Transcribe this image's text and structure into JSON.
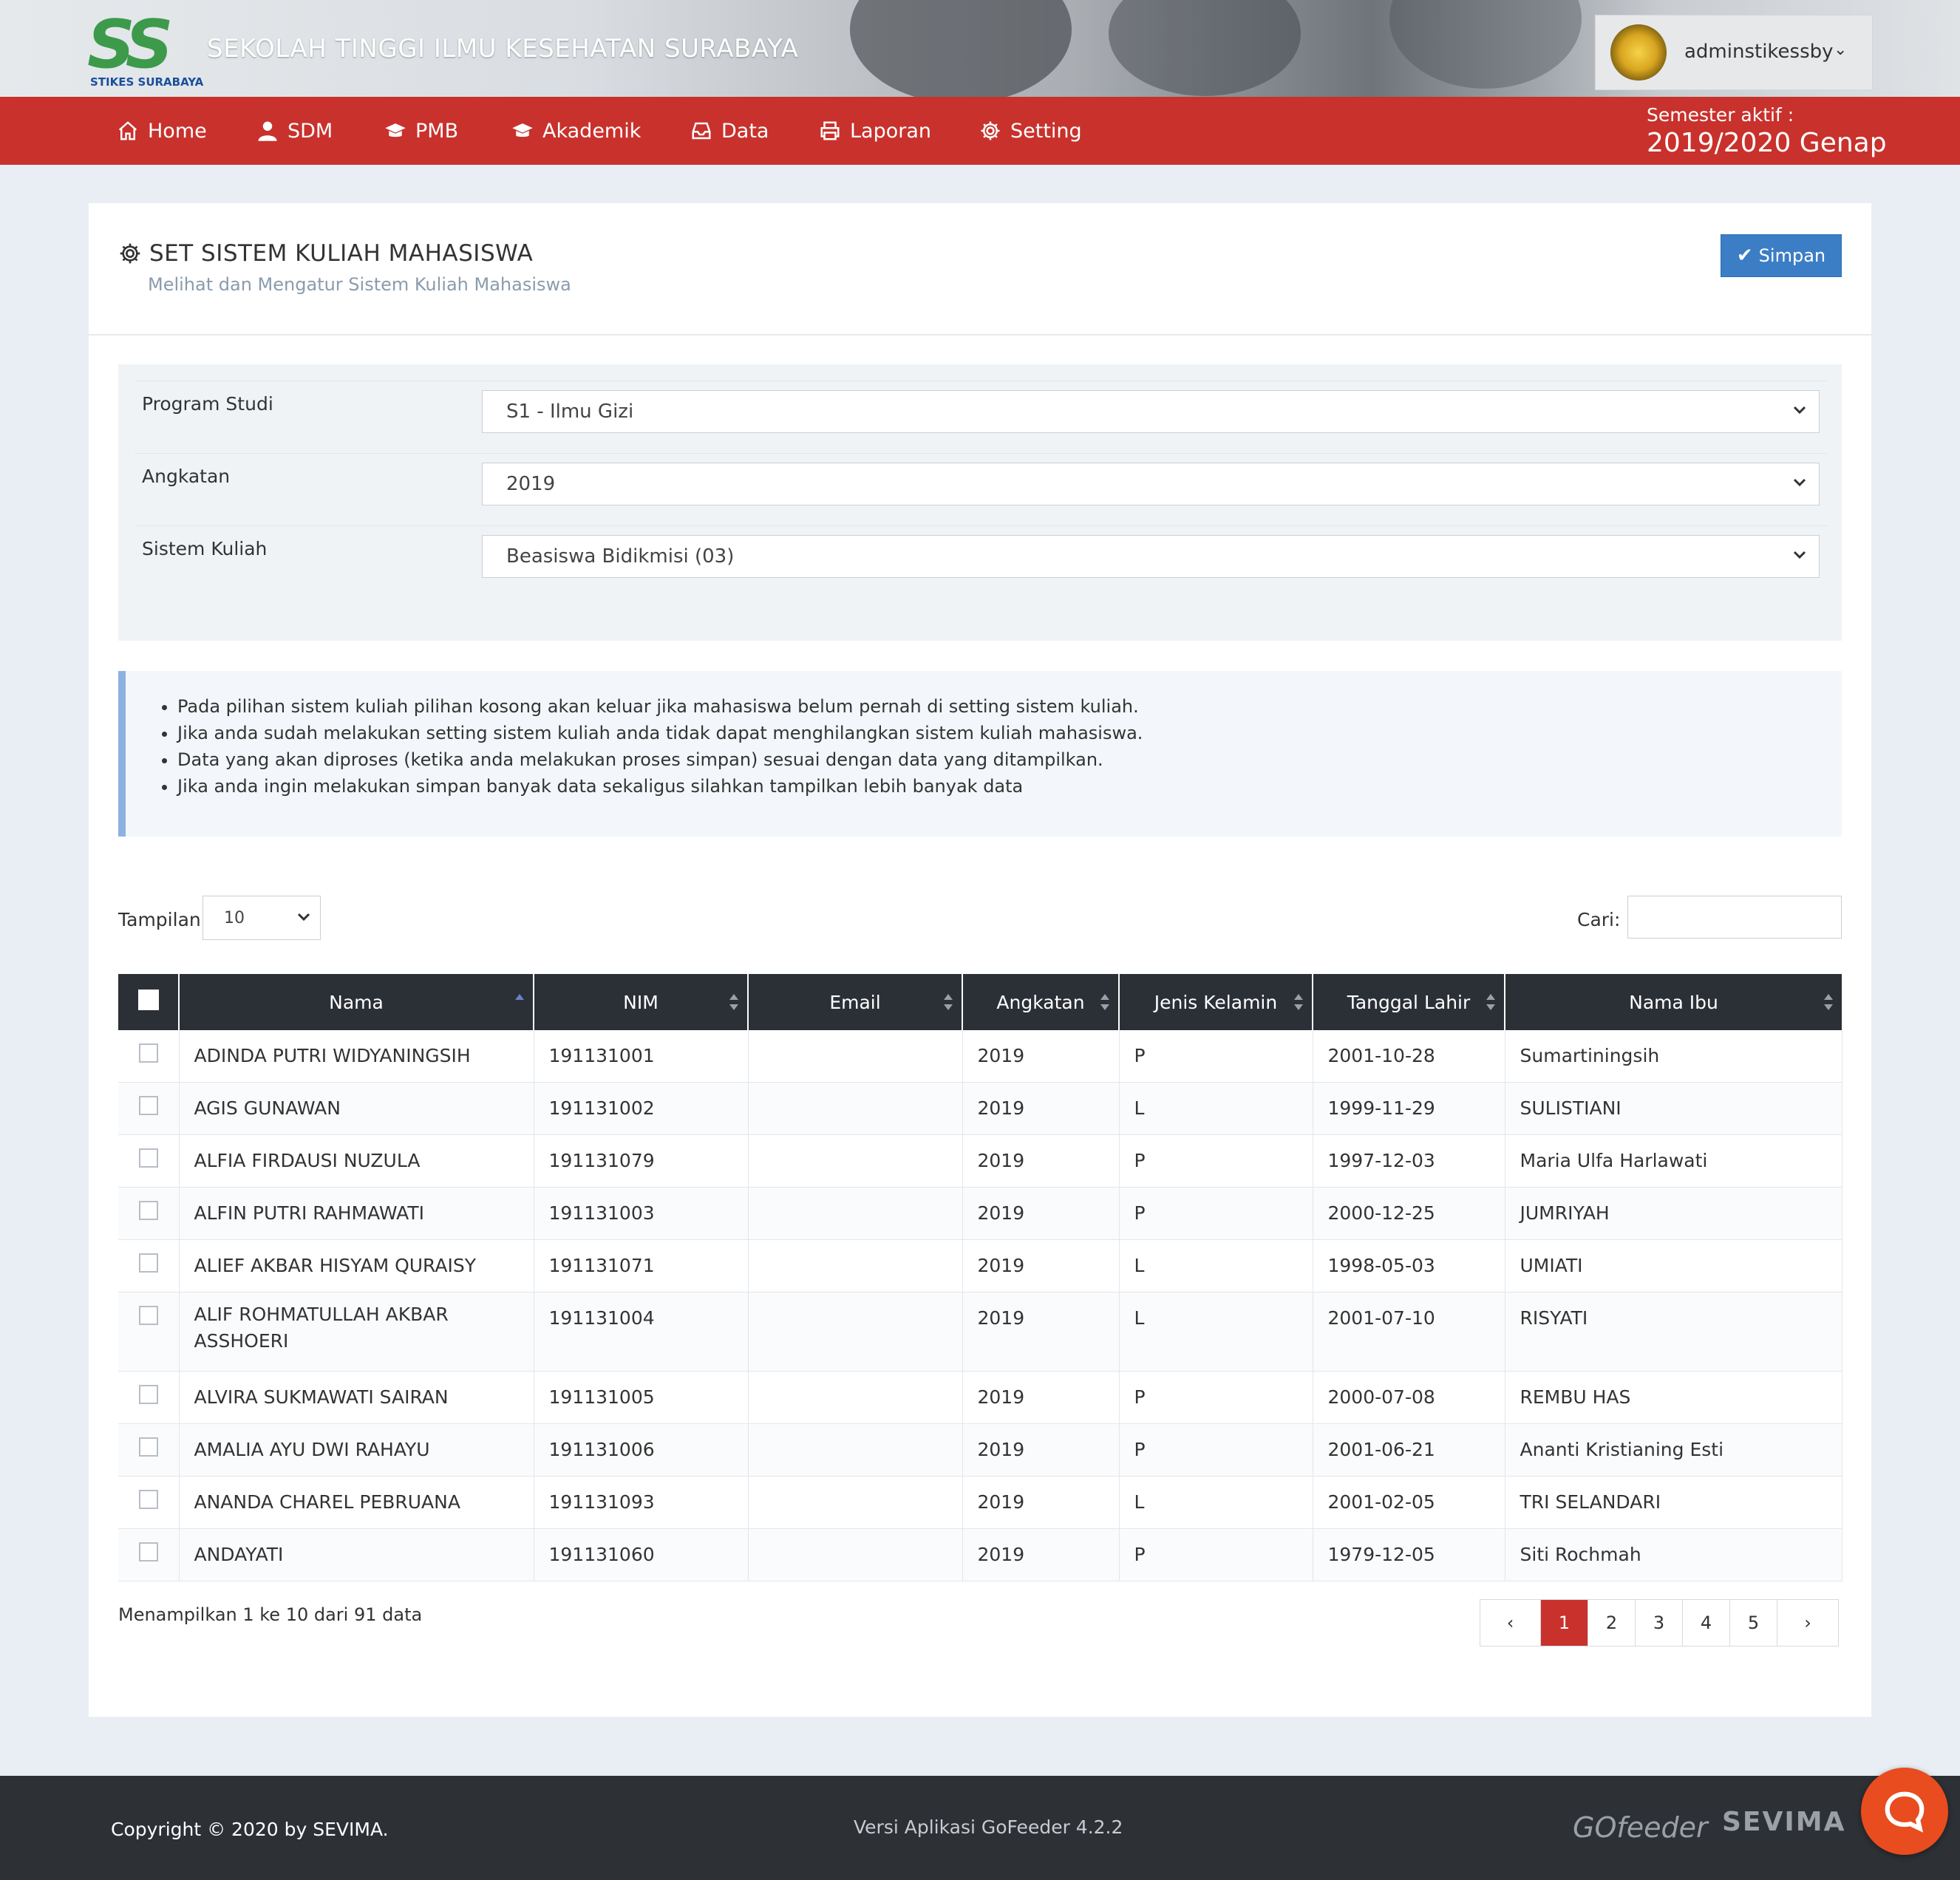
{
  "header": {
    "logo_mark": "SS",
    "logo_sub": "STIKES SURABAYA",
    "school_name": "SEKOLAH TINGGI ILMU KESEHATAN SURABAYA",
    "user_name": "adminstikessby"
  },
  "nav": {
    "items": [
      {
        "label": "Home",
        "icon": "home-icon"
      },
      {
        "label": "SDM",
        "icon": "user-icon"
      },
      {
        "label": "PMB",
        "icon": "graduation-cap-icon"
      },
      {
        "label": "Akademik",
        "icon": "graduation-cap-icon"
      },
      {
        "label": "Data",
        "icon": "inbox-icon"
      },
      {
        "label": "Laporan",
        "icon": "printer-icon"
      },
      {
        "label": "Setting",
        "icon": "gear-icon"
      }
    ],
    "semester_label": "Semester aktif :",
    "semester_value": "2019/2020 Genap"
  },
  "page": {
    "title": "SET SISTEM KULIAH MAHASISWA",
    "subtitle": "Melihat dan Mengatur Sistem Kuliah Mahasiswa",
    "save_label": "Simpan"
  },
  "form": {
    "program_studi_label": "Program Studi",
    "program_studi_value": "S1 - Ilmu Gizi",
    "angkatan_label": "Angkatan",
    "angkatan_value": "2019",
    "sistem_kuliah_label": "Sistem Kuliah",
    "sistem_kuliah_value": "Beasiswa Bidikmisi (03)"
  },
  "info": [
    "Pada pilihan sistem kuliah pilihan kosong akan keluar jika mahasiswa belum pernah di setting sistem kuliah.",
    "Jika anda sudah melakukan setting sistem kuliah anda tidak dapat menghilangkan sistem kuliah mahasiswa.",
    "Data yang akan diproses (ketika anda melakukan proses simpan) sesuai dengan data yang ditampilkan.",
    "Jika anda ingin melakukan simpan banyak data sekaligus silahkan tampilkan lebih banyak data"
  ],
  "table_controls": {
    "length_label": "Tampilan",
    "length_value": "10",
    "search_label": "Cari:"
  },
  "table": {
    "columns": [
      "Nama",
      "NIM",
      "Email",
      "Angkatan",
      "Jenis Kelamin",
      "Tanggal Lahir",
      "Nama Ibu"
    ],
    "rows": [
      [
        "ADINDA PUTRI WIDYANINGSIH",
        "191131001",
        "",
        "2019",
        "P",
        "2001-10-28",
        "Sumartiningsih"
      ],
      [
        "AGIS GUNAWAN",
        "191131002",
        "",
        "2019",
        "L",
        "1999-11-29",
        "SULISTIANI"
      ],
      [
        "ALFIA FIRDAUSI NUZULA",
        "191131079",
        "",
        "2019",
        "P",
        "1997-12-03",
        "Maria Ulfa Harlawati"
      ],
      [
        "ALFIN PUTRI RAHMAWATI",
        "191131003",
        "",
        "2019",
        "P",
        "2000-12-25",
        "JUMRIYAH"
      ],
      [
        "ALIEF AKBAR HISYAM QURAISY",
        "191131071",
        "",
        "2019",
        "L",
        "1998-05-03",
        "UMIATI"
      ],
      [
        "ALIF ROHMATULLAH AKBAR ASSHOERI",
        "191131004",
        "",
        "2019",
        "L",
        "2001-07-10",
        "RISYATI"
      ],
      [
        "ALVIRA SUKMAWATI SAIRAN",
        "191131005",
        "",
        "2019",
        "P",
        "2000-07-08",
        "REMBU HAS"
      ],
      [
        "AMALIA AYU DWI RAHAYU",
        "191131006",
        "",
        "2019",
        "P",
        "2001-06-21",
        "Ananti Kristianing Esti"
      ],
      [
        "ANANDA CHAREL PEBRUANA",
        "191131093",
        "",
        "2019",
        "L",
        "2001-02-05",
        "TRI SELANDARI"
      ],
      [
        "ANDAYATI",
        "191131060",
        "",
        "2019",
        "P",
        "1979-12-05",
        "Siti Rochmah"
      ]
    ]
  },
  "pagination": {
    "info": "Menampilkan 1 ke 10 dari 91 data",
    "prev": "‹",
    "pages": [
      "1",
      "2",
      "3",
      "4",
      "5"
    ],
    "active": "1",
    "next": "›"
  },
  "footer": {
    "copyright": "Copyright © 2020 by SEVIMA.",
    "version": "Versi Aplikasi GoFeeder 4.2.2",
    "brand1": "GOfeeder",
    "brand2": "SEVIMA"
  },
  "colors": {
    "nav_bg": "#c9312c",
    "primary_button": "#3b7ec5",
    "table_header": "#2b2f36",
    "footer_bg": "#2d3136",
    "chat_bubble": "#e84c1f"
  }
}
